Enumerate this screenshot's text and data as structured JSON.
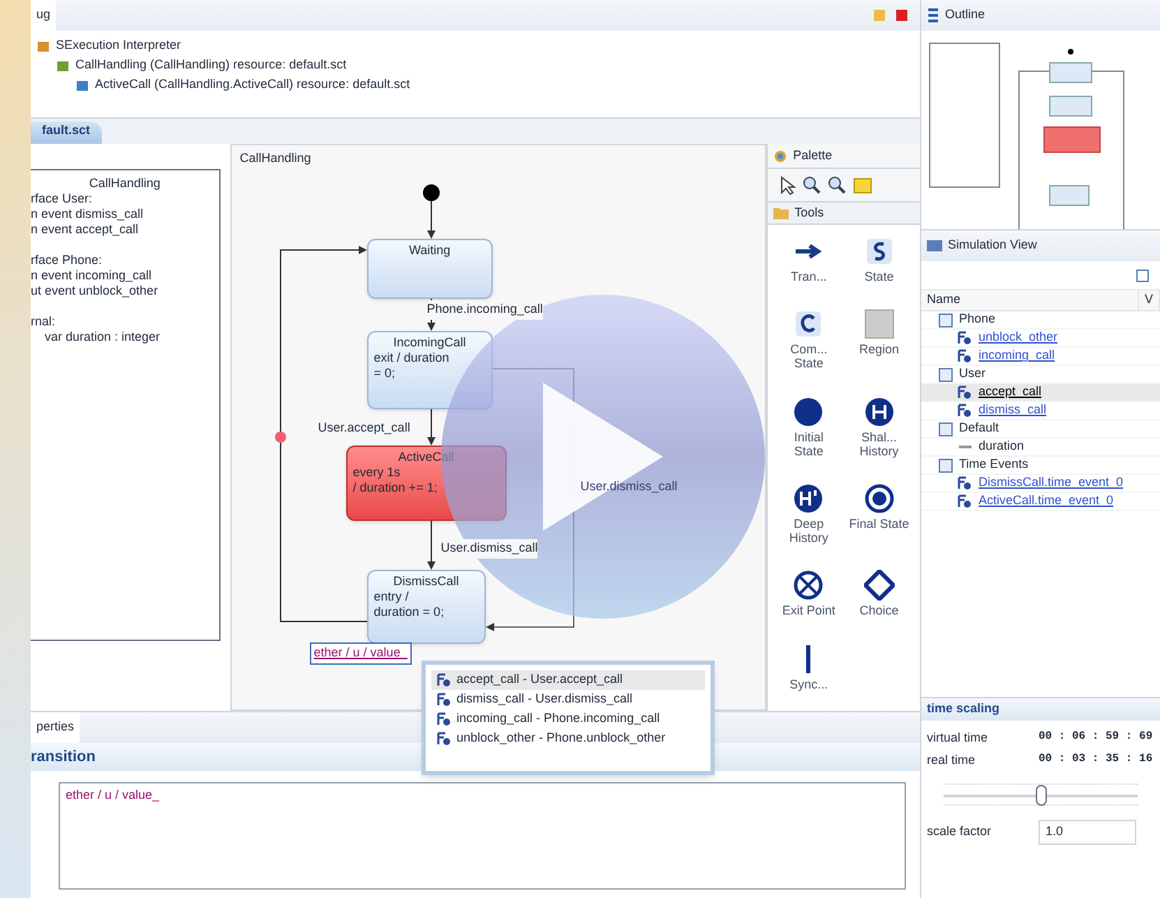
{
  "debug_view": {
    "tab": "ug",
    "tree": [
      {
        "label": "SExecution Interpreter",
        "children": [
          {
            "label": "CallHandling (CallHandling) resource: default.sct",
            "children": [
              {
                "label": "ActiveCall (CallHandling.ActiveCall) resource: default.sct"
              }
            ]
          }
        ]
      }
    ]
  },
  "editor": {
    "tab": "fault.sct",
    "definition": {
      "title": "CallHandling",
      "groups": [
        [
          "rface User:",
          "n event dismiss_call",
          "n event accept_call"
        ],
        [
          "rface Phone:",
          "n event incoming_call",
          "ut event unblock_other"
        ],
        [
          "rnal:",
          "    var duration : integer"
        ]
      ]
    },
    "diagram": {
      "region": "CallHandling",
      "states": [
        {
          "name": "Waiting",
          "active": false
        },
        {
          "name": "IncomingCall",
          "lines": [
            "exit / duration",
            "= 0;"
          ],
          "active": false
        },
        {
          "name": "ActiveCall",
          "lines": [
            "every 1s",
            "/ duration += 1;"
          ],
          "active": true
        },
        {
          "name": "DismissCall",
          "lines": [
            "entry /",
            "duration = 0;"
          ],
          "active": false
        }
      ],
      "transitions": [
        "Phone.incoming_call",
        "User.accept_call",
        "User.dismiss_call",
        "User.dismiss_call"
      ],
      "inline_edit": "ether / u / value_",
      "completions": [
        {
          "label": "accept_call - User.accept_call",
          "selected": true
        },
        {
          "label": "dismiss_call - User.dismiss_call",
          "selected": false
        },
        {
          "label": "incoming_call - Phone.incoming_call",
          "selected": false
        },
        {
          "label": "unblock_other - Phone.unblock_other",
          "selected": false
        }
      ]
    },
    "palette": {
      "title": "Palette",
      "drawer": "Tools",
      "tools": [
        {
          "kind": "transition",
          "label": "Tran..."
        },
        {
          "kind": "state",
          "label": "State"
        },
        {
          "kind": "composite",
          "label": "Com... State"
        },
        {
          "kind": "region",
          "label": "Region"
        },
        {
          "kind": "initial",
          "label": "Initial State"
        },
        {
          "kind": "shallow",
          "label": "Shal... History"
        },
        {
          "kind": "deep",
          "label": "Deep History"
        },
        {
          "kind": "final",
          "label": "Final State"
        },
        {
          "kind": "exit",
          "label": "Exit Point"
        },
        {
          "kind": "choice",
          "label": "Choice"
        },
        {
          "kind": "sync",
          "label": "Sync..."
        }
      ]
    }
  },
  "properties": {
    "tab": "perties",
    "section": "ransition",
    "expression": "ether / u / value_"
  },
  "outline": {
    "tab": "Outline"
  },
  "simulation_view": {
    "tab": "Simulation View",
    "columns": [
      "Name",
      "V"
    ],
    "rows": [
      {
        "kind": "interface",
        "label": "Phone",
        "children": [
          {
            "kind": "event",
            "label": "unblock_other",
            "selected": false
          },
          {
            "kind": "event",
            "label": "incoming_call",
            "selected": false
          }
        ]
      },
      {
        "kind": "interface",
        "label": "User",
        "children": [
          {
            "kind": "event",
            "label": "accept_call",
            "selected": true
          },
          {
            "kind": "event",
            "label": "dismiss_call",
            "selected": false
          }
        ]
      },
      {
        "kind": "interface",
        "label": "Default",
        "children": [
          {
            "kind": "variable",
            "label": "duration"
          }
        ]
      },
      {
        "kind": "interface",
        "label": "Time Events",
        "children": [
          {
            "kind": "event",
            "label": "DismissCall.time_event_0",
            "selected": false
          },
          {
            "kind": "event",
            "label": "ActiveCall.time_event_0",
            "selected": false
          }
        ]
      }
    ]
  },
  "time_scaling": {
    "title": "time scaling",
    "times": [
      {
        "label": "virtual time",
        "value": "00 : 06 : 59 : 69"
      },
      {
        "label": "real time",
        "value": "00 : 03 : 35 : 16"
      }
    ],
    "slider": {
      "level": 0.5
    },
    "scale_factor": {
      "label": "scale factor",
      "value": "1.0"
    }
  }
}
